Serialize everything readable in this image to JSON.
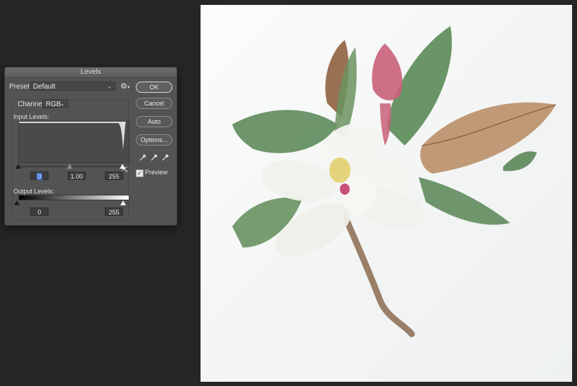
{
  "dialog": {
    "title": "Levels",
    "preset_label": "Preset:",
    "preset_value": "Default",
    "channel_label": "Channel:",
    "channel_value": "RGB",
    "input_levels_label": "Input Levels:",
    "input_black": "0",
    "input_gamma": "1.00",
    "input_white": "255",
    "output_levels_label": "Output Levels:",
    "output_black": "0",
    "output_white": "255",
    "buttons": {
      "ok": "OK",
      "cancel": "Cancel",
      "auto": "Auto",
      "options": "Options..."
    },
    "preview_label": "Preview",
    "preview_checked": true
  },
  "icons": {
    "gear": "gear-icon",
    "eyedropper_black": "eyedropper-black-icon",
    "eyedropper_gray": "eyedropper-gray-icon",
    "eyedropper_white": "eyedropper-white-icon",
    "cursor": "pointer-cursor-icon"
  },
  "colors": {
    "workspace": "#262626",
    "dialog_bg": "#535353",
    "histogram_fill": "#4a4a4a",
    "histogram_bg": "#dcdcdc",
    "leaf_green": "#5f8a5c",
    "leaf_brown": "#a77c52",
    "bud_pink": "#c9607a",
    "petal_white": "#f2f2ee"
  }
}
